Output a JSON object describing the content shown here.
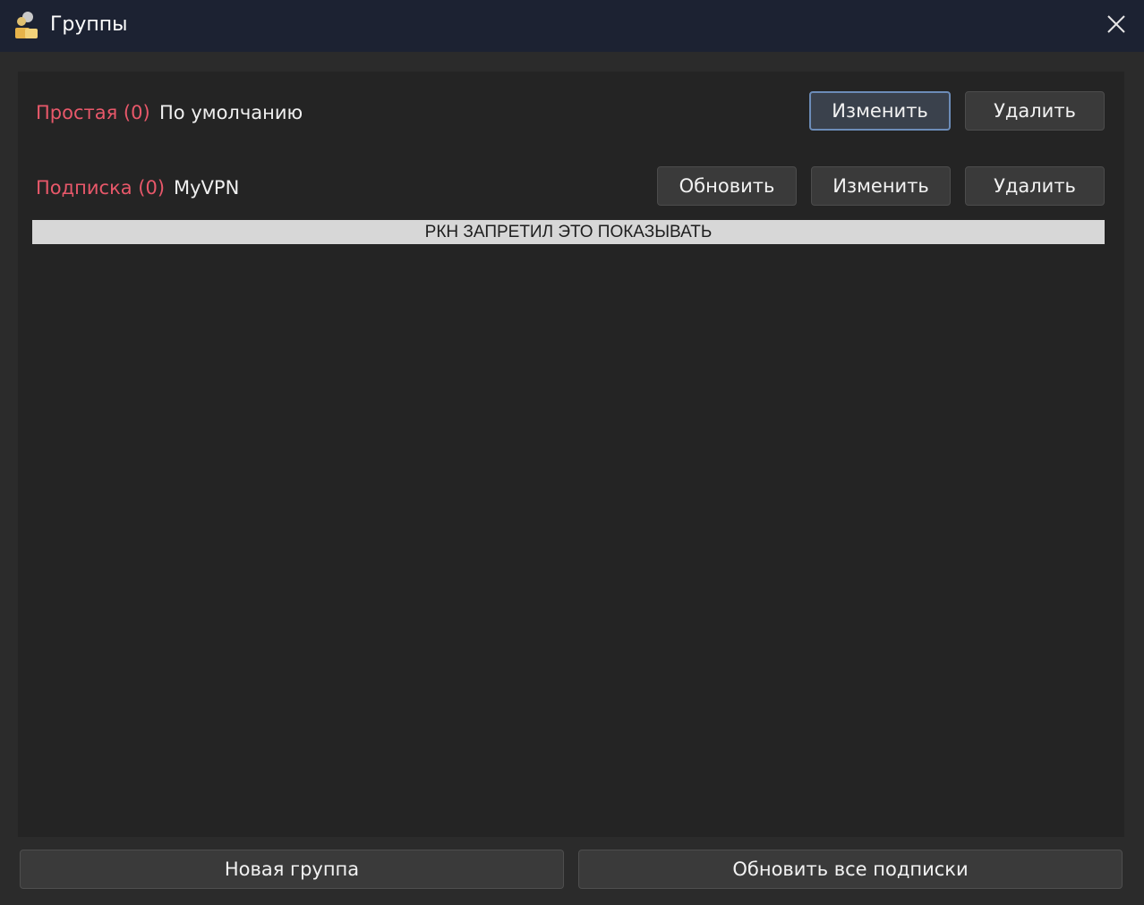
{
  "window": {
    "title": "Группы",
    "icon": "app-people-icon",
    "close_icon": "close-icon"
  },
  "groups": [
    {
      "type_label": "Простая (0)",
      "name": "По умолчанию",
      "buttons": [
        "Изменить",
        "Удалить"
      ]
    },
    {
      "type_label": "Подписка (0)",
      "name": "MyVPN",
      "buttons": [
        "Обновить",
        "Изменить",
        "Удалить"
      ]
    }
  ],
  "banner": "РКН ЗАПРЕТИЛ ЭТО ПОКАЗЫВАТЬ",
  "footer": {
    "new_group": "Новая группа",
    "update_all": "Обновить все подписки"
  },
  "colors": {
    "group_type": "#e8586a",
    "titlebar": "#1c2232",
    "background": "#2b2b2b",
    "panel": "#242424"
  }
}
